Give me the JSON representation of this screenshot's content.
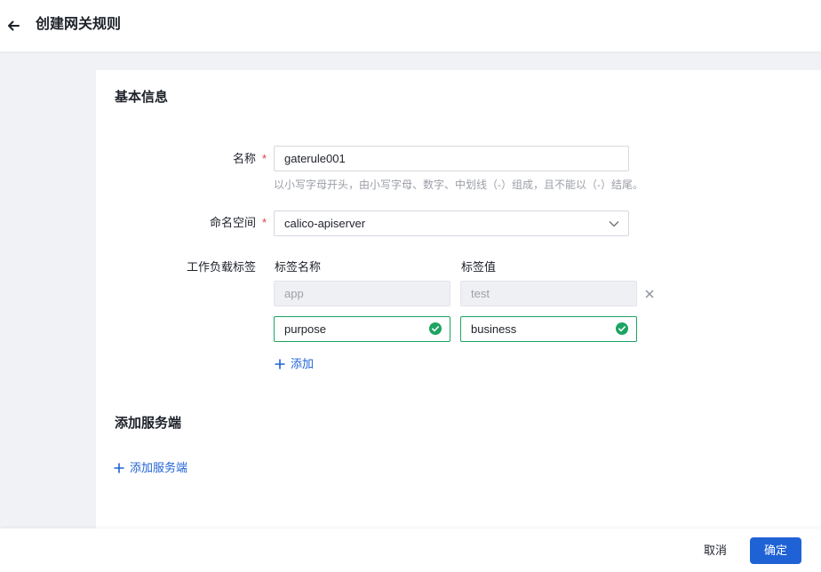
{
  "header": {
    "back_icon": "arrow-left-icon",
    "title": "创建网关规则"
  },
  "basic_info": {
    "title": "基本信息",
    "name": {
      "label": "名称",
      "required_mark": "*",
      "value": "gaterule001",
      "hint": "以小写字母开头，由小写字母、数字、中划线（-）组成，且不能以（-）结尾。"
    },
    "namespace": {
      "label": "命名空间",
      "required_mark": "*",
      "value": "calico-apiserver",
      "icon": "chevron-down-icon"
    },
    "workload_labels": {
      "label": "工作负载标签",
      "key_header": "标签名称",
      "value_header": "标签值",
      "rows": [
        {
          "key": "app",
          "value": "test",
          "disabled": true,
          "remove_icon": "close-icon"
        },
        {
          "key": "purpose",
          "value": "business",
          "valid": true,
          "status_icon": "check-circle-icon"
        }
      ],
      "add_label": "添加",
      "add_icon": "plus-icon"
    }
  },
  "servers": {
    "title": "添加服务端",
    "add_label": "添加服务端",
    "add_icon": "plus-icon"
  },
  "footer": {
    "cancel_label": "取消",
    "confirm_label": "确定"
  },
  "colors": {
    "primary": "#1f62d6",
    "success": "#1da462",
    "required": "#e5393e",
    "page_background": "#f1f2f5"
  }
}
